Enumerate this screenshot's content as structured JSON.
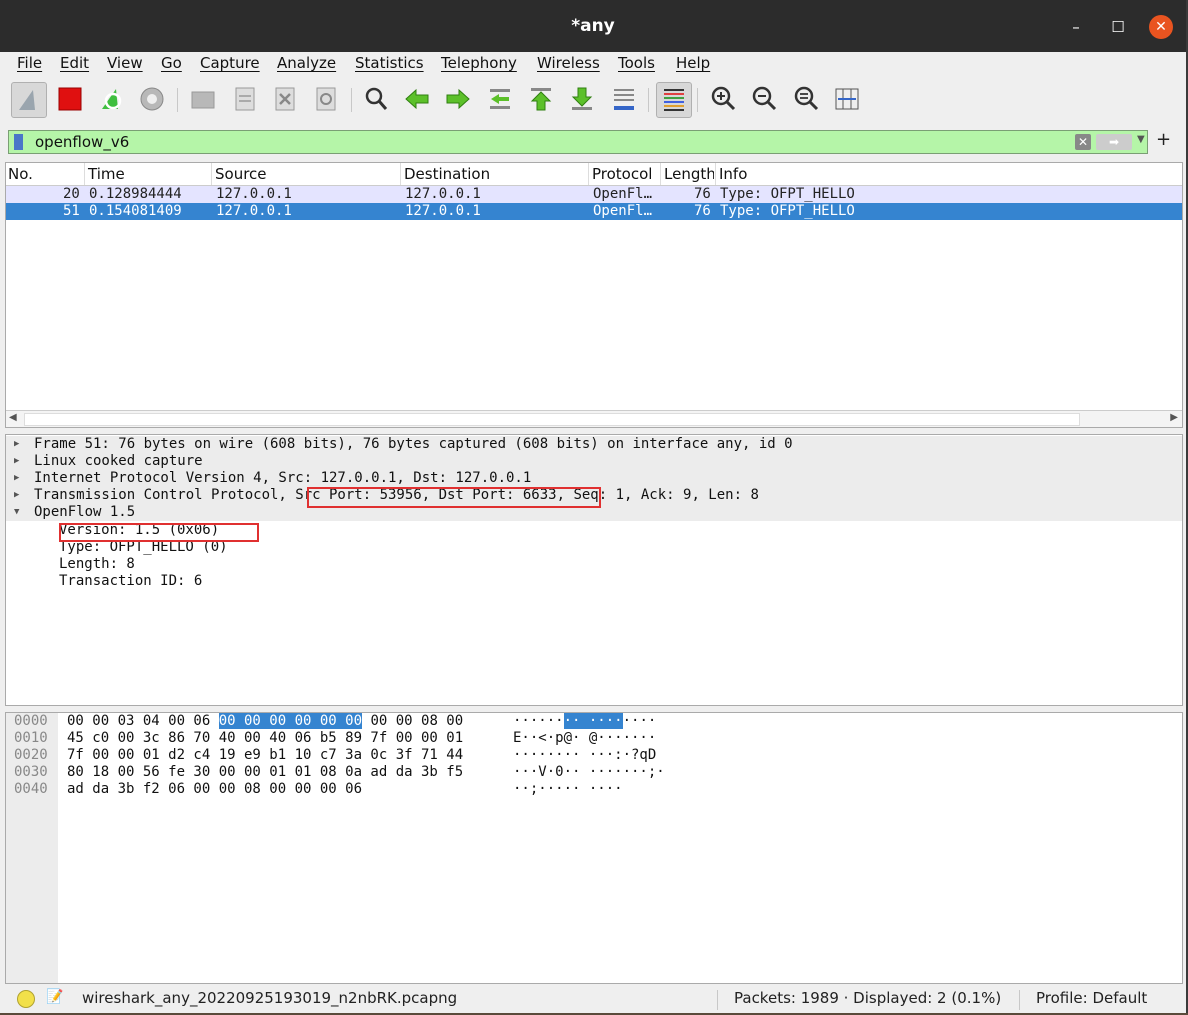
{
  "window": {
    "title": "*any",
    "min": "–",
    "max": "☐",
    "close": "✕"
  },
  "menu": [
    "File",
    "Edit",
    "View",
    "Go",
    "Capture",
    "Analyze",
    "Statistics",
    "Telephony",
    "Wireless",
    "Tools",
    "Help"
  ],
  "toolbar": {
    "icons": [
      "shark-fin-icon",
      "stop-capture-icon",
      "restart-capture-icon",
      "capture-options-icon",
      "open-file-icon",
      "save-file-icon",
      "close-file-icon",
      "reload-file-icon",
      "find-packet-icon",
      "go-back-icon",
      "go-forward-icon",
      "go-to-packet-icon",
      "go-first-icon",
      "go-last-icon",
      "autoscroll-icon",
      "colorize-icon",
      "zoom-in-icon",
      "zoom-out-icon",
      "zoom-normal-icon",
      "resize-columns-icon"
    ]
  },
  "filter": {
    "value": "openflow_v6",
    "plus": "+"
  },
  "packet_list": {
    "headers": [
      "No.",
      "Time",
      "Source",
      "Destination",
      "Protocol",
      "Length",
      "Info"
    ],
    "rows": [
      {
        "no": "20",
        "time": "0.128984444",
        "source": "127.0.0.1",
        "destination": "127.0.0.1",
        "protocol": "OpenFl…",
        "length": "76",
        "info": "Type: OFPT_HELLO"
      },
      {
        "no": "51",
        "time": "0.154081409",
        "source": "127.0.0.1",
        "destination": "127.0.0.1",
        "protocol": "OpenFl…",
        "length": "76",
        "info": "Type: OFPT_HELLO"
      }
    ]
  },
  "details": {
    "frame": "Frame 51: 76 bytes on wire (608 bits), 76 bytes captured (608 bits) on interface any, id 0",
    "linux": "Linux cooked capture",
    "ip": "Internet Protocol Version 4, Src: 127.0.0.1, Dst: 127.0.0.1",
    "tcp": "Transmission Control Protocol, Src Port: 53956, Dst Port: 6633, Seq: 1, Ack: 9, Len: 8",
    "openflow": "OpenFlow 1.5",
    "version": "Version: 1.5 (0x06)",
    "type": "Type: OFPT_HELLO (0)",
    "length": "Length: 8",
    "xid": "Transaction ID: 6"
  },
  "bytes": {
    "offsets": [
      "0000",
      "0010",
      "0020",
      "0030",
      "0040"
    ],
    "row0": {
      "hex_a": "00 00 03 04 00 06 ",
      "hex_hl": "00 00  00 00 00 00",
      "hex_b": " 00 00 08 00",
      "asc_a": "······",
      "asc_hl": "·· ····",
      "asc_b": "····"
    },
    "hex": [
      "",
      "45 c0 00 3c 86 70 40 00  40 06 b5 89 7f 00 00 01",
      "7f 00 00 01 d2 c4 19 e9  b1 10 c7 3a 0c 3f 71 44",
      "80 18 00 56 fe 30 00 00  01 01 08 0a ad da 3b f5",
      "ad da 3b f2 06 00 00 08  00 00 00 06"
    ],
    "ascii": [
      "",
      "E··<·p@· @·······",
      "········ ···:·?qD",
      "···V·0·· ·······;·",
      "··;····· ····"
    ]
  },
  "status": {
    "file": "wireshark_any_20220925193019_n2nbRK.pcapng",
    "packets": "Packets: 1989 · Displayed: 2 (0.1%)",
    "profile": "Profile: Default"
  }
}
